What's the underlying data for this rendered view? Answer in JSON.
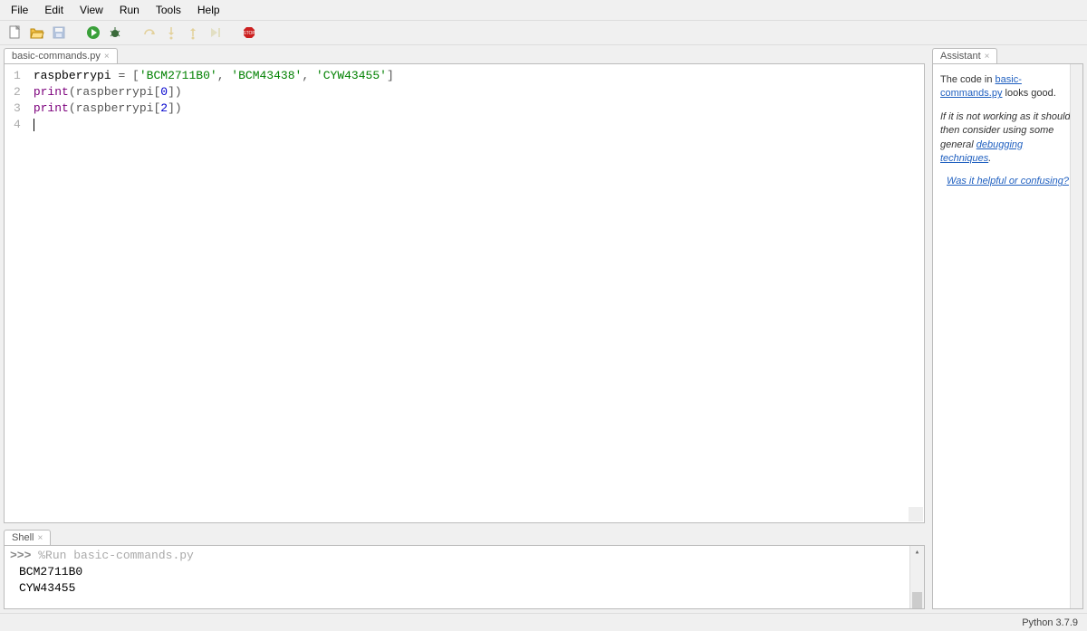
{
  "menu": [
    "File",
    "Edit",
    "View",
    "Run",
    "Tools",
    "Help"
  ],
  "toolbar": {
    "new": "new-file-icon",
    "open": "open-file-icon",
    "save": "save-icon",
    "run": "run-icon",
    "debug": "debug-icon",
    "over": "step-over-icon",
    "into": "step-into-icon",
    "out": "step-out-icon",
    "resume": "resume-icon",
    "stop": "stop-icon"
  },
  "editor": {
    "tab_label": "basic-commands.py",
    "lines": [
      {
        "num": "1",
        "tokens": [
          {
            "t": "name",
            "v": "raspberrypi"
          },
          {
            "t": "txt",
            "v": " = ["
          },
          {
            "t": "str",
            "v": "'BCM2711B0'"
          },
          {
            "t": "txt",
            "v": ", "
          },
          {
            "t": "str",
            "v": "'BCM43438'"
          },
          {
            "t": "txt",
            "v": ", "
          },
          {
            "t": "str",
            "v": "'CYW43455'"
          },
          {
            "t": "txt",
            "v": "]"
          }
        ]
      },
      {
        "num": "2",
        "tokens": [
          {
            "t": "builtin",
            "v": "print"
          },
          {
            "t": "txt",
            "v": "(raspberrypi["
          },
          {
            "t": "num",
            "v": "0"
          },
          {
            "t": "txt",
            "v": "])"
          }
        ]
      },
      {
        "num": "3",
        "tokens": [
          {
            "t": "builtin",
            "v": "print"
          },
          {
            "t": "txt",
            "v": "(raspberrypi["
          },
          {
            "t": "num",
            "v": "2"
          },
          {
            "t": "txt",
            "v": "])"
          }
        ]
      },
      {
        "num": "4",
        "tokens": []
      }
    ]
  },
  "shell": {
    "tab_label": "Shell",
    "prompt": ">>> ",
    "run_cmd": "%Run basic-commands.py",
    "output": [
      "BCM2711B0",
      "CYW43455"
    ]
  },
  "assistant": {
    "tab_label": "Assistant",
    "p1_prefix": "The code in ",
    "p1_link": "basic-commands.py",
    "p1_suffix": " looks good.",
    "p2_prefix": "If it is not working as it should, then consider using some general ",
    "p2_link": "debugging techniques",
    "p2_suffix": ".",
    "feedback": "Was it helpful or confusing?"
  },
  "status": {
    "python_version": "Python 3.7.9"
  }
}
